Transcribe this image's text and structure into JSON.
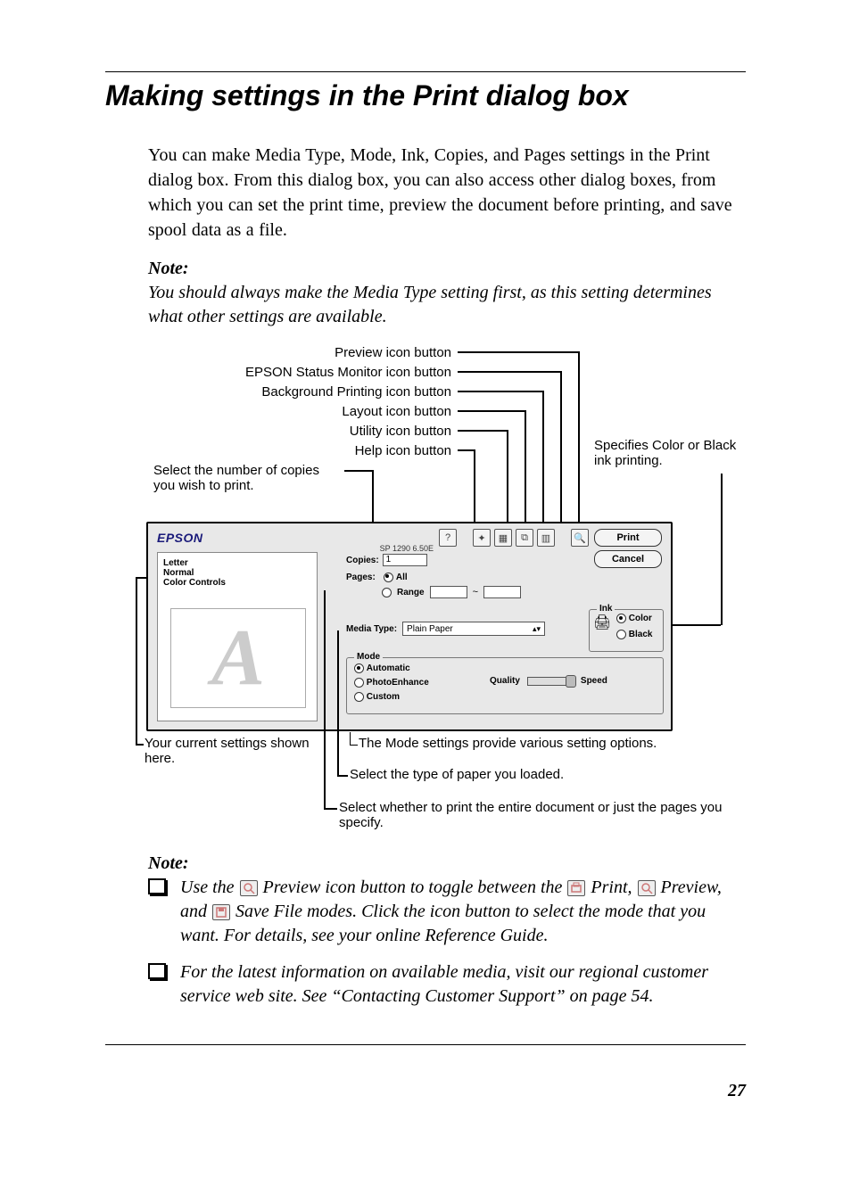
{
  "title": "Making settings in the Print dialog box",
  "intro": "You can make Media Type, Mode, Ink, Copies, and Pages settings in the Print dialog box. From this dialog box, you can also access other dialog boxes, from which you can set the print time, preview the document before printing, and save spool data as a file.",
  "note1_head": "Note:",
  "note1_body": "You should always make the Media Type setting first, as this setting determines what other settings are available.",
  "callouts": {
    "preview": "Preview icon button",
    "status": "EPSON Status Monitor icon button",
    "bg": "Background Printing icon button",
    "layout": "Layout icon button",
    "utility": "Utility icon button",
    "help": "Help icon button",
    "copies": "Select the number of copies you wish to print.",
    "ink": "Specifies Color or Black ink printing.",
    "mode": "The Mode settings provide various setting options.",
    "media": "Select the type of paper you loaded.",
    "pages": "Select whether to print the entire document or just the pages you specify.",
    "current": "Your current settings shown here."
  },
  "dialog": {
    "brand": "EPSON",
    "version": "SP 1290 6.50E",
    "print_btn": "Print",
    "cancel_btn": "Cancel",
    "settings_line1": "Letter",
    "settings_line2": "Normal",
    "settings_line3": "Color Controls",
    "copies_label": "Copies:",
    "copies_value": "1",
    "pages_label": "Pages:",
    "pages_all": "All",
    "pages_range": "Range",
    "range_sep": "~",
    "media_label": "Media Type:",
    "media_value": "Plain Paper",
    "ink_legend": "Ink",
    "ink_color": "Color",
    "ink_black": "Black",
    "mode_legend": "Mode",
    "mode_auto": "Automatic",
    "mode_photo": "PhotoEnhance",
    "mode_custom": "Custom",
    "quality": "Quality",
    "speed": "Speed"
  },
  "note2_head": "Note:",
  "note2": {
    "li1_a": "Use the ",
    "li1_b": " Preview icon button to toggle between the ",
    "li1_c": " Print, ",
    "li1_d": " Preview, and ",
    "li1_e": " Save File modes. Click the icon button to select the mode that you want. For details, see your online Reference Guide.",
    "li2": "For the latest information on available media, visit our regional customer service web site. See “Contacting Customer Support” on page 54."
  },
  "page_number": "27"
}
